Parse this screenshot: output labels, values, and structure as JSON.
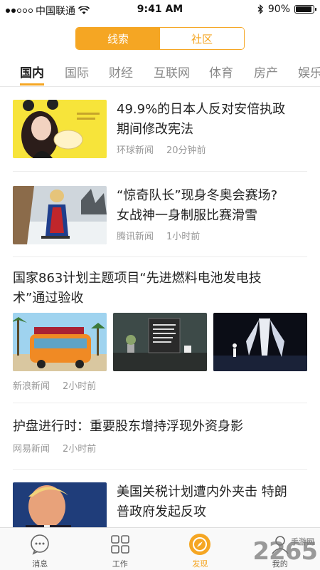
{
  "status_bar": {
    "carrier": "中国联通",
    "time": "9:41 AM",
    "battery": "90%",
    "battery_level": 0.9
  },
  "segment": {
    "options": [
      "线索",
      "社区"
    ],
    "selected": "线索"
  },
  "tabs": [
    "国内",
    "国际",
    "财经",
    "互联网",
    "体育",
    "房产",
    "娱乐"
  ],
  "active_tab": "国内",
  "feed": [
    {
      "title": "49.9%的日本人反对安倍执政期间修改宪法",
      "title_lines": [
        "49.9%的日本人反对安倍执政",
        "期间修改宪法"
      ],
      "source": "环球新闻",
      "time": "20分钟前"
    },
    {
      "title": "“惊奇队长”现身冬奥会赛场?女战神一身制服比赛滑雪",
      "title_lines": [
        "“惊奇队长”现身冬奥会赛场?",
        "女战神一身制服比赛滑雪"
      ],
      "source": "腾讯新闻",
      "time": "1小时前"
    },
    {
      "title": "国家863计划主题项目“先进燃料电池发电技术”通过验收",
      "title_lines": [
        "国家863计划主题项目“先进燃料电池发电技",
        "术”通过验收"
      ],
      "source": "新浪新闻",
      "time": "2小时前"
    },
    {
      "title": "护盘进行时：重要股东增持浮现外资身影",
      "source": "网易新闻",
      "time": "2小时前"
    },
    {
      "title": "美国关税计划遭内外夹击 特朗普政府发起反攻",
      "title_lines": [
        "美国关税计划遭内外夹击 特朗",
        "普政府发起反攻"
      ]
    }
  ],
  "bottom_nav": [
    "消息",
    "工作",
    "发现",
    "我的"
  ],
  "active_nav": "发现",
  "watermark": {
    "main": "2265",
    "sub": "手游网"
  },
  "colors": {
    "accent": "#f5a623",
    "text": "#222222",
    "meta": "#999999"
  }
}
